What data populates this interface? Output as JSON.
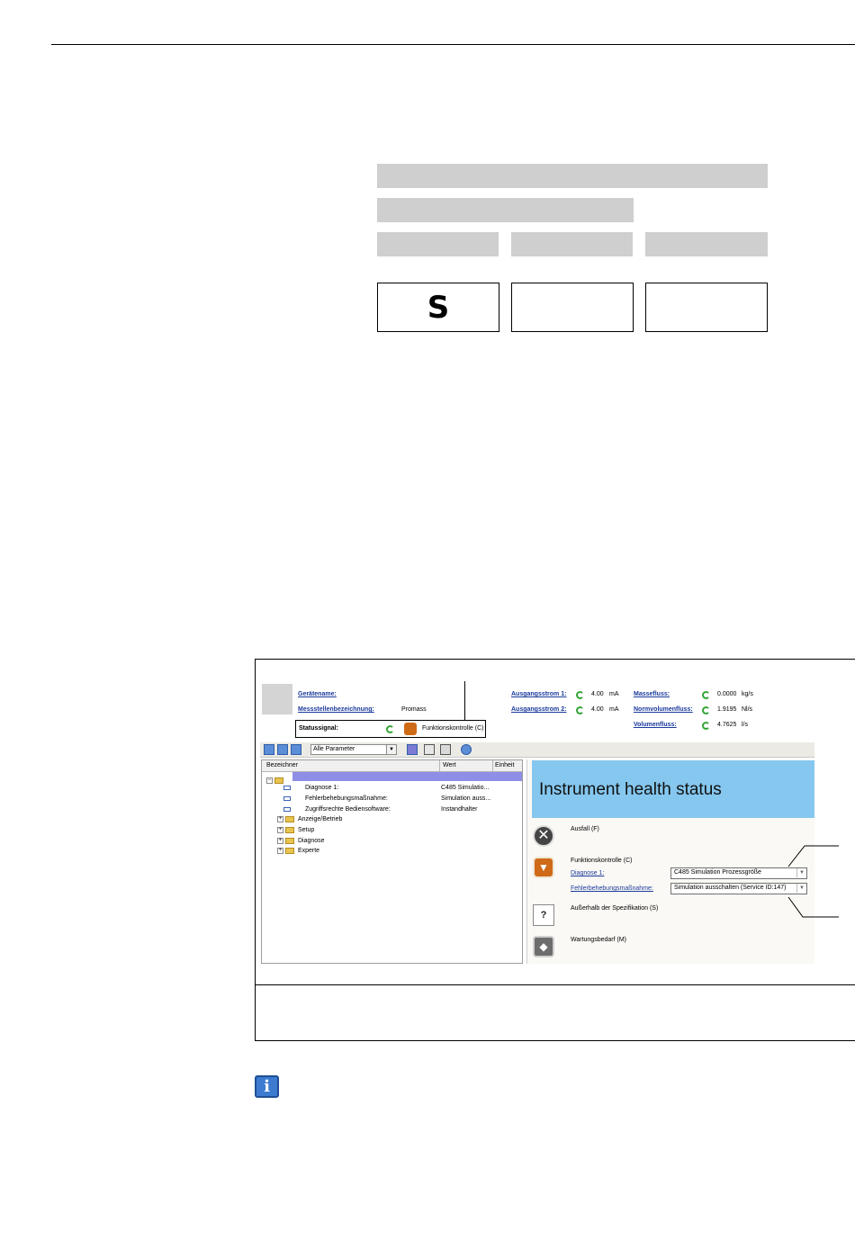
{
  "code_table": {
    "cell_1": "S",
    "cell_2": "",
    "cell_3": ""
  },
  "device_panel": {
    "geraetename_label": "Gerätename:",
    "messstelle_label": "Messstellenbezeichnung:",
    "messstelle_value": "Promass",
    "statussignal_label": "Statussignal:",
    "statussignal_value": "Funktionskontrolle (C)"
  },
  "measurements": [
    {
      "label": "Ausgangsstrom 1:",
      "value": "4.00",
      "unit": "mA"
    },
    {
      "label": "Ausgangsstrom 2:",
      "value": "4.00",
      "unit": "mA"
    },
    {
      "label": "Massefluss:",
      "value": "0.0000",
      "unit": "kg/s"
    },
    {
      "label": "Normvolumenfluss:",
      "value": "1.9195",
      "unit": "Nl/s"
    },
    {
      "label": "Volumenfluss:",
      "value": "4.7625",
      "unit": "l/s"
    }
  ],
  "toolbar": {
    "filter_value": "Alle Parameter"
  },
  "tree": {
    "col_name": "Bezeichner",
    "col_value": "Wert",
    "col_unit": "Einheit",
    "params": [
      {
        "name": "Diagnose 1:",
        "value": "C485 Simulatio..."
      },
      {
        "name": "Fehlerbehebungsmaßnahme:",
        "value": "Simulation auss..."
      },
      {
        "name": "Zugriffsrechte Bediensoftware:",
        "value": "Instandhalter"
      }
    ],
    "folders": [
      "Anzeige/Betrieb",
      "Setup",
      "Diagnose",
      "Experte"
    ]
  },
  "health": {
    "title": "Instrument health status",
    "ausfall": "Ausfall (F)",
    "funktionskontrolle": "Funktionskontrolle (C)",
    "diagnose_label": "Diagnose 1:",
    "diagnose_value": "C485 Simulation Prozessgröße",
    "fehler_label": "Fehlerbehebungsmaßnahme:",
    "fehler_value": "Simulation ausschalten  (Service ID:147)",
    "ausserhalb": "Außerhalb der Spezifikation (S)",
    "wartung": "Wartungsbedarf (M)"
  },
  "colors": {
    "banner": "#85c7ef",
    "link": "#1a3a9c",
    "status_c": "#cf6a17"
  }
}
